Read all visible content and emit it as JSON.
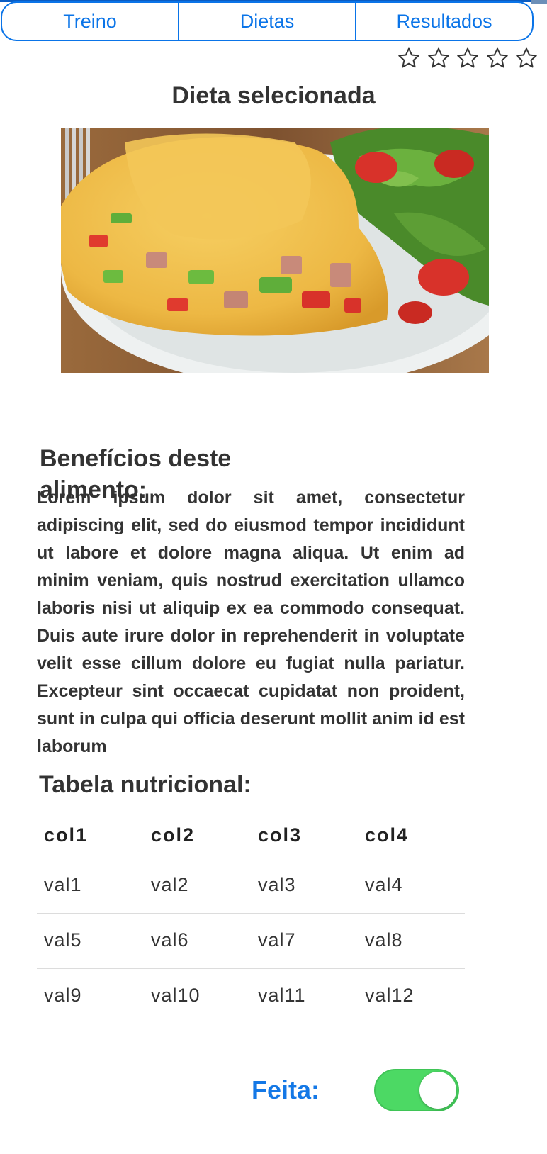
{
  "tabs": [
    {
      "label": "Treino"
    },
    {
      "label": "Dietas"
    },
    {
      "label": "Resultados"
    }
  ],
  "rating": {
    "max": 5,
    "value": 0,
    "icon": "star-outline-icon"
  },
  "page_title": "Dieta selecionada",
  "image": {
    "subject": "omelete-icon"
  },
  "benefits": {
    "title": "Benefícios deste alimento:",
    "text": "Lorem ipsum dolor sit amet, consectetur adipiscing elit, sed do eiusmod tempor incididunt ut labore et dolore magna aliqua. Ut enim ad minim veniam, quis nostrud exercitation ullamco laboris nisi ut aliquip ex ea commodo consequat. Duis aute irure dolor in reprehenderit in voluptate velit esse cillum dolore eu fugiat nulla pariatur. Excepteur sint occaecat cupidatat non proident, sunt in culpa qui officia deserunt mollit anim id est laborum"
  },
  "nutrition": {
    "title": "Tabela nutricional:",
    "columns": [
      "col1",
      "col2",
      "col3",
      "col4"
    ],
    "rows": [
      [
        "val1",
        "val2",
        "val3",
        "val4"
      ],
      [
        "val5",
        "val6",
        "val7",
        "val8"
      ],
      [
        "val9",
        "val10",
        "val11",
        "val12"
      ]
    ]
  },
  "done": {
    "label": "Feita:",
    "value": true
  },
  "colors": {
    "accent": "#0a74e8",
    "toggle_on": "#4cd964",
    "text": "#333333"
  }
}
